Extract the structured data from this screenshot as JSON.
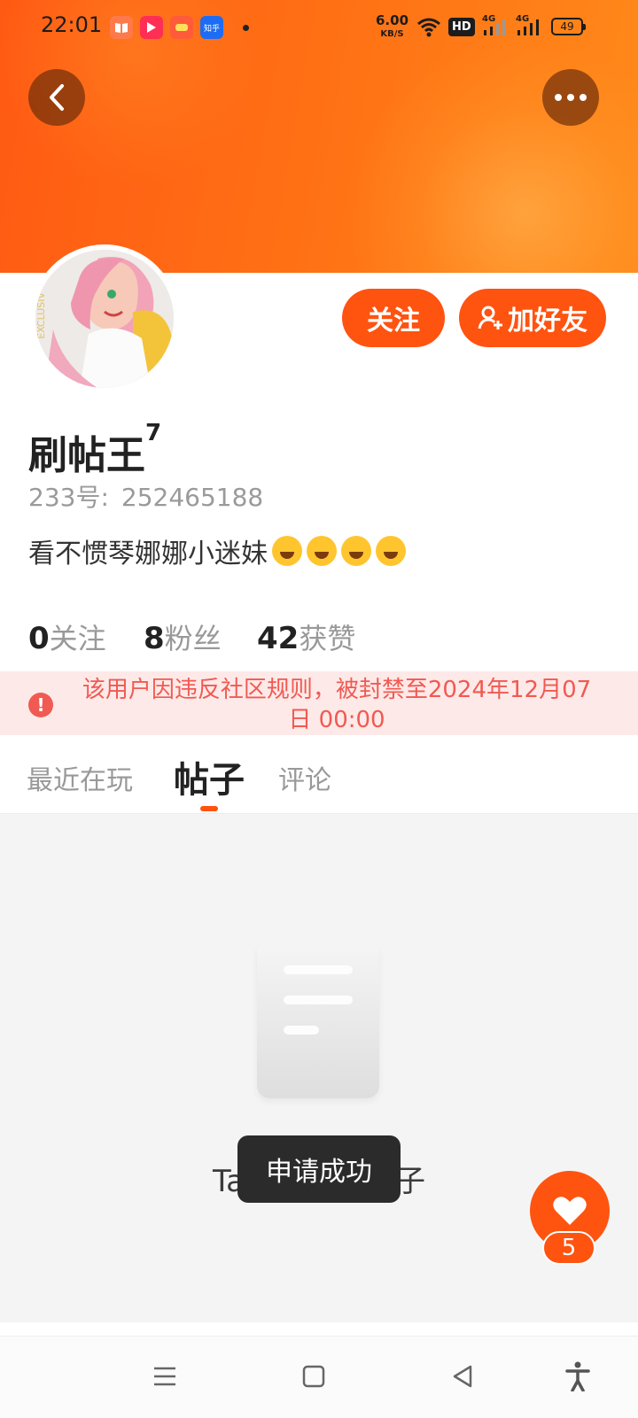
{
  "status_bar": {
    "time": "22:01",
    "app_icons": [
      "books-app-icon",
      "video-app-icon",
      "game-app-icon",
      "zhihu-app-icon"
    ],
    "zhihu_label": "知乎",
    "speed_value": "6.00",
    "speed_unit": "KB/S",
    "hd_label": "HD",
    "net1": "4G",
    "net2": "4G",
    "battery": "49"
  },
  "header": {
    "back_icon": "chevron-left-icon",
    "more_icon": "more-dots-icon",
    "colors": {
      "from": "#ff5a13",
      "to": "#ff8a1a"
    }
  },
  "profile": {
    "follow_label": "关注",
    "add_friend_label": "加好友",
    "name": "刷帖王",
    "level": "7",
    "id_label": "233号:",
    "id_value": "252465188",
    "bio_text": "看不惯琴娜娜小迷妹",
    "bio_emoji_count": 4,
    "avatar_text": "EXCLUSIV"
  },
  "stats": [
    {
      "value": "0",
      "label": "关注"
    },
    {
      "value": "8",
      "label": "粉丝"
    },
    {
      "value": "42",
      "label": "获赞"
    }
  ],
  "ban_notice": {
    "text": "该用户因违反社区规则，被封禁至2024年12月07日 00:00",
    "color": "#f05a52"
  },
  "tabs": [
    {
      "label": "最近在玩",
      "active": false
    },
    {
      "label": "帖子",
      "active": true
    },
    {
      "label": "评论",
      "active": false
    }
  ],
  "empty_state": {
    "text": "Ta还没发过帖子"
  },
  "toast": {
    "text": "申请成功"
  },
  "fab": {
    "icon": "heart-icon",
    "count": "5"
  },
  "nav_bar": {
    "icons": [
      "menu-icon",
      "home-square-icon",
      "back-triangle-icon",
      "accessibility-icon"
    ]
  },
  "accent_color": "#ff5310"
}
